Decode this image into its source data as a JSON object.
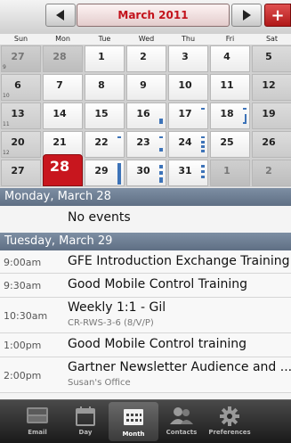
{
  "header": {
    "month_label": "March 2011",
    "prev_icon": "triangle-left-icon",
    "next_icon": "triangle-right-icon",
    "add_label": "+"
  },
  "weekdays": [
    "Sun",
    "Mon",
    "Tue",
    "Wed",
    "Thu",
    "Fri",
    "Sat"
  ],
  "weeks": [
    {
      "week": "9",
      "days": [
        "27",
        "28",
        "1",
        "2",
        "3",
        "4",
        "5"
      ]
    },
    {
      "week": "10",
      "days": [
        "6",
        "7",
        "8",
        "9",
        "10",
        "11",
        "12"
      ]
    },
    {
      "week": "11",
      "days": [
        "13",
        "14",
        "15",
        "16",
        "17",
        "18",
        "19"
      ]
    },
    {
      "week": "12",
      "days": [
        "20",
        "21",
        "22",
        "23",
        "24",
        "25",
        "26"
      ]
    },
    {
      "week": "",
      "days": [
        "27",
        "28",
        "29",
        "30",
        "31",
        "1",
        "2"
      ]
    }
  ],
  "agenda": {
    "monday_header": "Monday, March 28",
    "monday_empty": "No events",
    "tuesday_header": "Tuesday, March 29",
    "events": [
      {
        "time": "9:00am",
        "title": "GFE Introduction Exchange Training",
        "location": ""
      },
      {
        "time": "9:30am",
        "title": "Good Mobile Control Training",
        "location": ""
      },
      {
        "time": "10:30am",
        "title": "Weekly 1:1 - Gil",
        "location": "CR-RWS-3-6 (8/V/P)"
      },
      {
        "time": "1:00pm",
        "title": "Good Mobile Control training",
        "location": ""
      },
      {
        "time": "2:00pm",
        "title": "Gartner Newsletter Audience and ...",
        "location": "Susan's Office"
      }
    ]
  },
  "tabs": [
    {
      "label": "Email",
      "icon": "good-email-icon"
    },
    {
      "label": "Day",
      "icon": "day-calendar-icon"
    },
    {
      "label": "Month",
      "icon": "month-grid-icon"
    },
    {
      "label": "Contacts",
      "icon": "contacts-people-icon"
    },
    {
      "label": "Preferences",
      "icon": "gear-icon"
    }
  ],
  "colors": {
    "accent": "#c8161e",
    "event_bar": "#3d73b8",
    "day_header": "#6b7b90"
  }
}
